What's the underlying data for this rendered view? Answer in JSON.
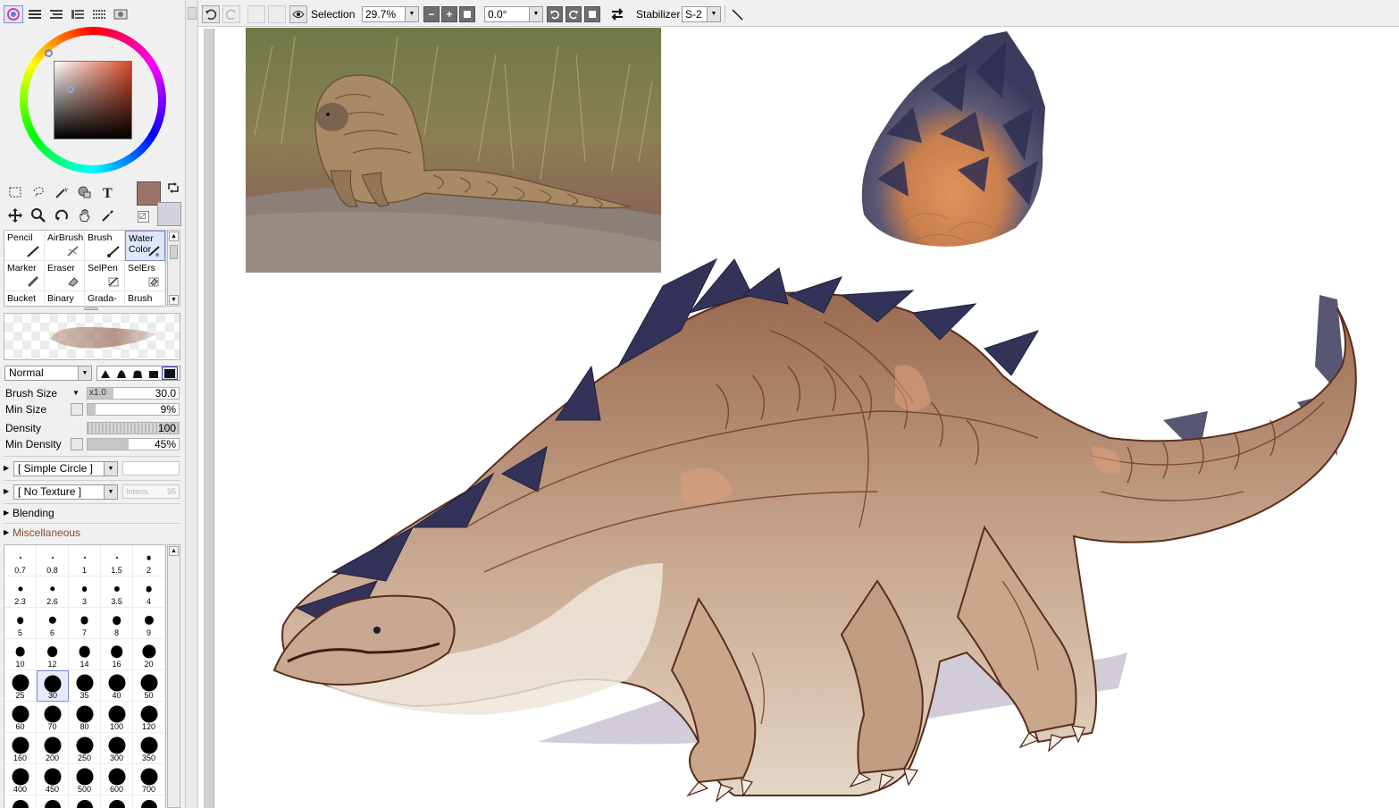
{
  "toolbar": {
    "icons": [
      "deselect-icon",
      "undo-icon",
      "redo-icon",
      "zoom-out-icon",
      "zoom-in-icon",
      "eye-icon",
      "rotate-left-icon",
      "rotate-right-icon",
      "flip-icon",
      "stabilizer-pen-icon"
    ],
    "selection_label": "Selection",
    "zoom_value": "29.7%",
    "rotation_value": "0.0°",
    "stabilizer_label": "Stabilizer",
    "stabilizer_value": "S-2"
  },
  "colors": {
    "main_color": "#9a7465",
    "sub_color": "#d6d1de",
    "accent": "#7f8fd6"
  },
  "brush_tools": [
    {
      "label": "Pencil",
      "icon": "pencil-icon"
    },
    {
      "label": "AirBrush",
      "icon": "airbrush-icon"
    },
    {
      "label": "Brush",
      "icon": "brush-icon"
    },
    {
      "label": "Water Color",
      "icon": "watercolor-icon",
      "active": true
    },
    {
      "label": "Marker",
      "icon": "marker-icon"
    },
    {
      "label": "Eraser",
      "icon": "eraser-icon"
    },
    {
      "label": "SelPen",
      "icon": "selpen-icon"
    },
    {
      "label": "SelErs",
      "icon": "selers-icon"
    },
    {
      "label": "Bucket",
      "icon": "bucket-icon"
    },
    {
      "label": "Binary",
      "icon": "binary-icon"
    },
    {
      "label": "Grada-",
      "icon": "gradation-icon"
    },
    {
      "label": "Brush",
      "icon": "brush-icon"
    }
  ],
  "brush_settings": {
    "blend_mode": "Normal",
    "brush_size_label": "Brush Size",
    "brush_size_multiplier": "x1.0",
    "brush_size_value": "30.0",
    "min_size_label": "Min Size",
    "min_size_value": "9%",
    "min_size_fraction": 0.09,
    "density_label": "Density",
    "density_value": "100",
    "density_fraction": 1.0,
    "min_density_label": "Min Density",
    "min_density_value": "45%",
    "min_density_fraction": 0.45,
    "brush_shape": "[ Simple Circle ]",
    "texture": "[ No Texture ]",
    "intensity_label": "Intens.",
    "intensity_value": "95",
    "blending_label": "Blending",
    "misc_label": "Miscellaneous"
  },
  "size_palette": [
    "0.7",
    "0.8",
    "1",
    "1.5",
    "2",
    "2.3",
    "2.6",
    "3",
    "3.5",
    "4",
    "5",
    "6",
    "7",
    "8",
    "9",
    "10",
    "12",
    "14",
    "16",
    "20",
    "25",
    "30",
    "35",
    "40",
    "50",
    "60",
    "70",
    "80",
    "100",
    "120",
    "160",
    "200",
    "250",
    "300",
    "350",
    "400",
    "450",
    "500",
    "600",
    "700",
    "",
    "",
    "",
    "",
    ""
  ],
  "size_palette_selected": "30",
  "canvas": {
    "reference_photo": "pangolin-reference-photo",
    "artwork": "armored-dragon-sketch"
  }
}
